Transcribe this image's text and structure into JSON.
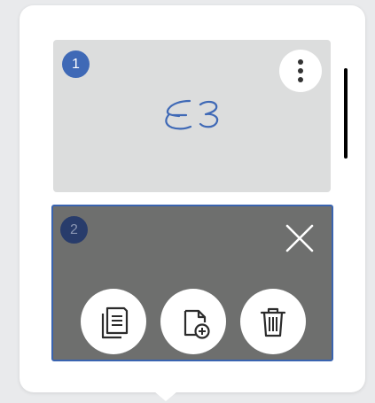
{
  "pages": [
    {
      "number": "1",
      "thumbnail_text": "E3",
      "selected": false,
      "menu_icon": "more-vertical-icon"
    },
    {
      "number": "2",
      "selected": true,
      "close_icon": "close-icon",
      "actions": [
        {
          "name": "copy-page",
          "icon": "copy-icon"
        },
        {
          "name": "new-page",
          "icon": "add-page-icon"
        },
        {
          "name": "delete-page",
          "icon": "trash-icon"
        }
      ]
    }
  ],
  "colors": {
    "accent": "#3f69b6",
    "selected_border": "#3a64b0",
    "selected_background": "#6e6f6e",
    "thumbnail_background": "#dcdddd",
    "ink": "#3f69b6"
  }
}
